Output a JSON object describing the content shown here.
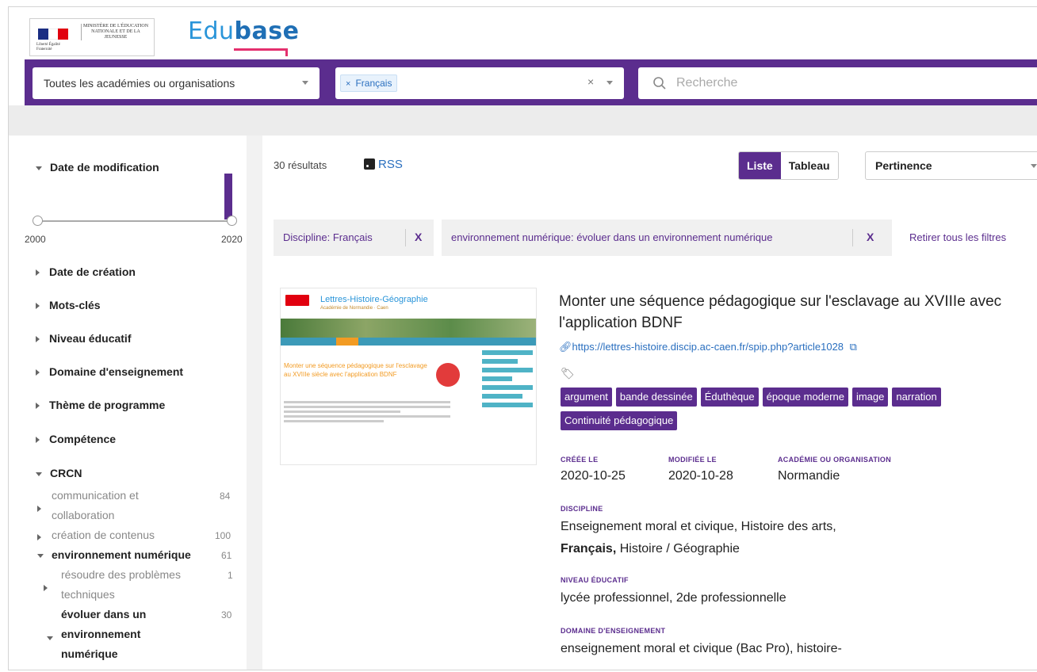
{
  "header": {
    "ministry_text": "Ministère de l'éducation nationale et de la jeunesse",
    "rf_text": "Liberté Égalité Fraternité",
    "brand_light": "Edu",
    "brand_bold": "base"
  },
  "search": {
    "academy_select": "Toutes les académies ou organisations",
    "discipline_chip": "Français",
    "chip_remove": "×",
    "clear_symbol": "×",
    "placeholder": "Recherche"
  },
  "sidebar": {
    "date_modif": "Date de modification",
    "year_start": "2000",
    "year_end": "2020",
    "facets": [
      "Date de création",
      "Mots-clés",
      "Niveau éducatif",
      "Domaine d'enseignement",
      "Thème de programme",
      "Compétence"
    ],
    "crcn": "CRCN",
    "crcn_items": [
      {
        "label": "communication et collaboration",
        "count": "84"
      },
      {
        "label": "création de contenus",
        "count": "100"
      },
      {
        "label": "environnement numérique",
        "count": "61"
      },
      {
        "label": "résoudre des problèmes techniques",
        "count": "1"
      },
      {
        "label": "évoluer dans un environnement numérique",
        "count": "30"
      }
    ]
  },
  "main": {
    "results": "30 résultats",
    "rss": "RSS",
    "view_list": "Liste",
    "view_table": "Tableau",
    "sort": "Pertinence",
    "filter1": "Discipline: Français",
    "filter2": "environnement numérique: évoluer dans un environnement numérique",
    "filter_x": "X",
    "reset": "Retirer tous les filtres"
  },
  "thumb": {
    "title": "Lettres-Histoire-Géographie",
    "subtitle": "Académie de Normandie · Caen",
    "heading": "Monter une séquence pédagogique sur l'esclavage au XVIIIe siècle avec l'application BDNF"
  },
  "result": {
    "title": "Monter une séquence pédagogique sur l'esclavage au XVIIIe avec l'application BDNF",
    "link": "https://lettres-histoire.discip.ac-caen.fr/spip.php?article1028",
    "tags": [
      "argument",
      "bande dessinée",
      "Éduthèque",
      "époque moderne",
      "image",
      "narration",
      "Continuité pédagogique"
    ],
    "created_label": "Créée le",
    "created": "2020-10-25",
    "modified_label": "Modifiée le",
    "modified": "2020-10-28",
    "academy_label": "Académie ou organisation",
    "academy": "Normandie",
    "discipline_label": "Discipline",
    "discipline_line1": "Enseignement moral et civique, Histoire des arts,",
    "discipline_bold": "Français,",
    "discipline_line2_rest": " Histoire / Géographie",
    "niveau_label": "Niveau éducatif",
    "niveau": "lycée professionnel, 2de professionnelle",
    "domaine_label": "Domaine d'enseignement",
    "domaine": "enseignement moral et civique (Bac Pro), histoire-"
  },
  "colors": {
    "primary": "#5b2d8e",
    "link": "#2a6fbf",
    "accent": "#e4306e"
  }
}
